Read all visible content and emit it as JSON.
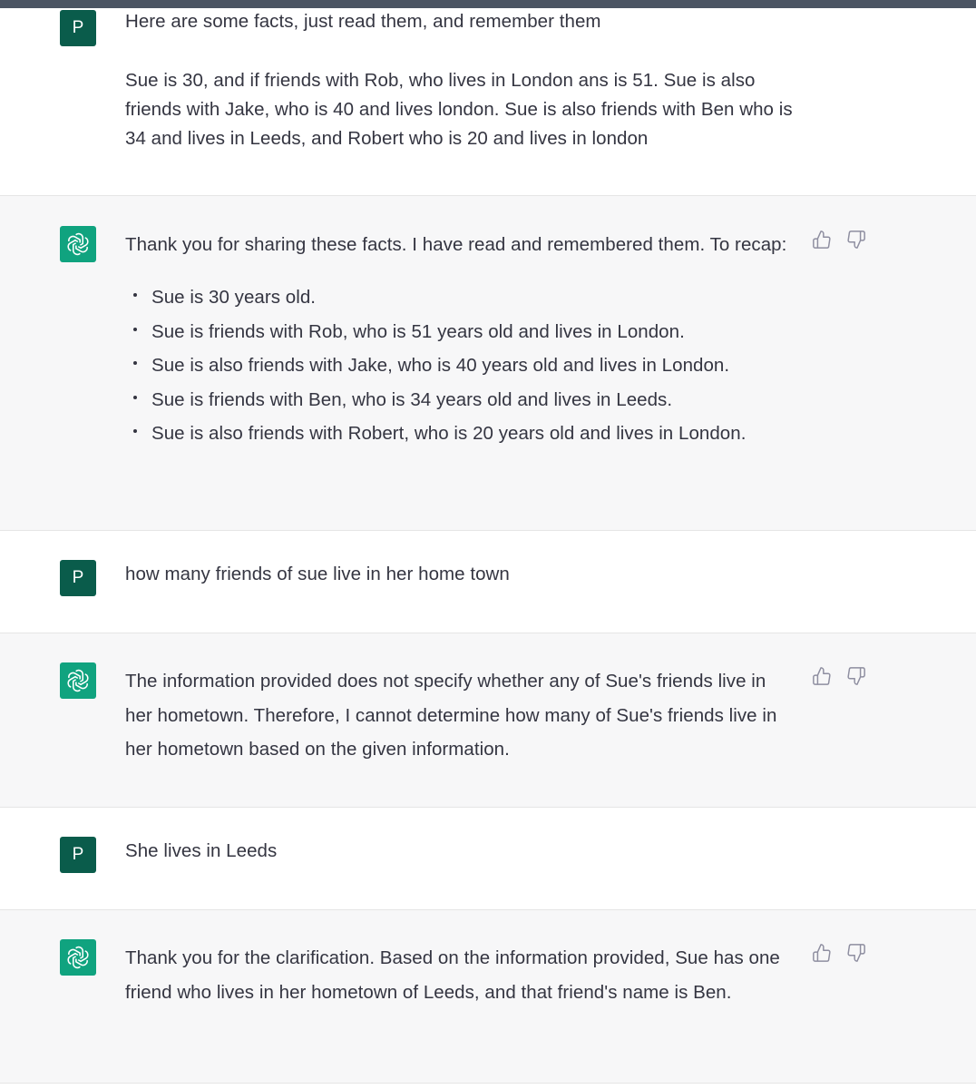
{
  "conversation": {
    "messages": [
      {
        "role": "user",
        "avatar_letter": "P",
        "paragraphs": [
          "Here are some facts, just read them, and remember them",
          "Sue is 30, and if friends with Rob, who lives in London ans is 51.  Sue is also friends with Jake, who is 40 and lives london. Sue is also friends with Ben who is 34 and lives in Leeds, and Robert who is 20 and lives in london"
        ]
      },
      {
        "role": "assistant",
        "intro": "Thank you for sharing these facts. I have read and remembered them. To recap:",
        "bullets": [
          "Sue is 30 years old.",
          "Sue is friends with Rob, who is 51 years old and lives in London.",
          "Sue is also friends with Jake, who is 40 years old and lives in London.",
          "Sue is friends with Ben, who is 34 years old and lives in Leeds.",
          "Sue is also friends with Robert, who is 20 years old and lives in London."
        ]
      },
      {
        "role": "user",
        "avatar_letter": "P",
        "text": "how many friends of sue live in her home town"
      },
      {
        "role": "assistant",
        "text": "The information provided does not specify whether any of Sue's friends live in her hometown. Therefore, I cannot determine how many of Sue's friends live in her hometown based on the given information."
      },
      {
        "role": "user",
        "avatar_letter": "P",
        "text": "She lives in Leeds"
      },
      {
        "role": "assistant",
        "text": "Thank you for the clarification. Based on the information provided, Sue has one friend who lives in her hometown of Leeds, and that friend's name is Ben."
      }
    ]
  },
  "icons": {
    "user_avatar": "letter-avatar",
    "assistant_avatar": "openai-logo-icon",
    "feedback_up": "thumbs-up-icon",
    "feedback_down": "thumbs-down-icon"
  },
  "colors": {
    "user_avatar_bg": "#0a5c4b",
    "assistant_avatar_bg": "#10a37f",
    "assistant_row_bg": "#f7f7f8",
    "text": "#343541",
    "icon": "#8e8ea0"
  }
}
